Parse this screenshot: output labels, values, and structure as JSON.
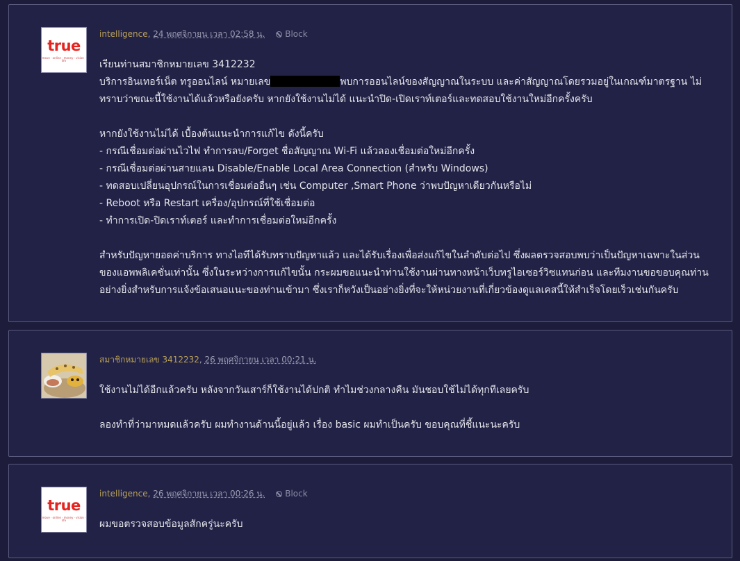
{
  "comments": [
    {
      "author": "intelligence",
      "date": "24 พฤศจิกายน เวลา 02:58 น.",
      "block": "Block",
      "avatar": "true-logo",
      "lines": {
        "l1": "เรียนท่านสมาชิกหมายเลข 3412232",
        "l2a": "บริการอินเทอร์เน็ต ทรูออนไลน์ หมายเลข",
        "l2b": "พบการออนไลน์ของสัญญาณในระบบ และค่าสัญญาณโดยรวมอยู่ในเกณฑ์มาตรฐาน ไม่",
        "l3": "ทราบว่าขณะนี้ใช้งานได้แล้วหรือยังครับ หากยังใช้งานไม่ได้ แนะนำปิด-เปิดเราท์เตอร์และทดสอบใช้งานใหม่อีกครั้งครับ",
        "l4": "หากยังใช้งานไม่ได้ เบื้องต้นแนะนำการแก้ไข ดังนี้ครับ",
        "l5": "- กรณีเชื่อมต่อผ่านไวไฟ ทำการลบ/Forget ชื่อสัญญาณ Wi-Fi แล้วลองเชื่อมต่อใหม่อีกครั้ง",
        "l6": "- กรณีเชื่อมต่อผ่านสายแลน Disable/Enable Local Area Connection (สำหรับ Windows)",
        "l7": "- ทดสอบเปลี่ยนอุปกรณ์ในการเชื่อมต่ออื่นๆ เช่น Computer ,Smart Phone ว่าพบปัญหาเดียวกันหรือไม่",
        "l8": "- Reboot หรือ Restart เครื่อง/อุปกรณ์ที่ใช้เชื่อมต่อ",
        "l9": "- ทำการเปิด-ปิดเราท์เตอร์ และทำการเชื่อมต่อใหม่อีกครั้ง",
        "l10": "สำหรับปัญหายอดค่าบริการ ทางไอทีได้รับทราบปัญหาแล้ว และได้รับเรื่องเพื่อส่งแก้ไขในลำดับต่อไป ซึ่งผลตรวจสอบพบว่าเป็นปัญหาเฉพาะในส่วน",
        "l11": "ของแอพพลิเคชั่นเท่านั้น ซึ่งในระหว่างการแก้ไขนั้น กระผมขอแนะนำท่านใช้งานผ่านทางหน้าเว็บทรูไอเซอร์วิซแทนก่อน และทีมงานขอขอบคุณท่าน",
        "l12": "อย่างยิ่งสำหรับการแจ้งข้อเสนอแนะของท่านเข้ามา ซึ่งเราก็หวังเป็นอย่างยิ่งที่จะให้หน่วยงานที่เกี่ยวข้องดูแลเคสนี้ให้สำเร็จโดยเร็วเช่นกันครับ"
      }
    },
    {
      "author": "สมาชิกหมายเลข 3412232",
      "date": "26 พฤศจิกายน เวลา 00:21 น.",
      "avatar": "photo-avatar",
      "lines": {
        "l1": "ใช้งานไม่ได้อีกแล้วครับ หลังจากวันเสาร์ก็ใช้งานได้ปกติ ทำไมช่วงกลางคืน มันชอบใช้ไม่ได้ทุกทีเลยครับ",
        "l2": "ลองทำที่ว่ามาหมดแล้วครับ ผมทำงานด้านนี้อยู่แล้ว เรื่อง basic ผมทำเป็นครับ ขอบคุณที่ชี้แนะนะครับ"
      }
    },
    {
      "author": "intelligence",
      "date": "26 พฤศจิกายน เวลา 00:26 น.",
      "block": "Block",
      "avatar": "true-logo",
      "lines": {
        "l1": "ผมขอตรวจสอบข้อมูลสักครู่นะครับ"
      }
    }
  ],
  "logo": {
    "word": "true",
    "tagline": "move · online · money · vision · life"
  },
  "colors": {
    "background": "#1d1d3b",
    "card": "#222246",
    "author": "#b9a15a",
    "logo_red": "#e5241f"
  }
}
